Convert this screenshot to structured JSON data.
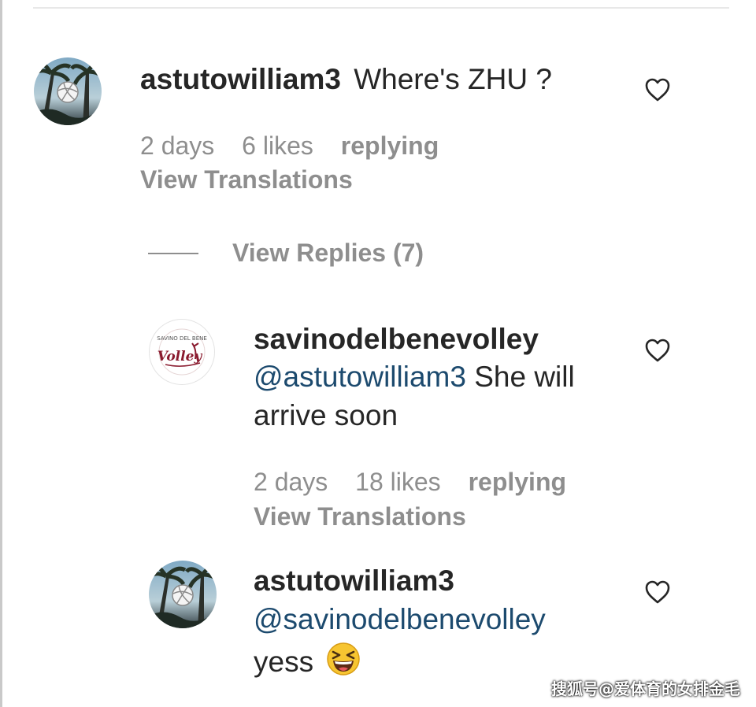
{
  "colors": {
    "username": "#262626",
    "meta": "#8e8e8e",
    "mention": "#1c4a6e",
    "background": "#ffffff"
  },
  "comments": [
    {
      "username": "astutowilliam3",
      "text": "Where's ZHU ?",
      "time": "2 days",
      "likes": "6 likes",
      "reply_label": "replying",
      "translate_label": "View Translations",
      "avatar_icon": "palm-tree-volleyball-avatar",
      "like_icon": "heart-icon"
    }
  ],
  "view_replies_label": "View Replies (7)",
  "replies": [
    {
      "username": "savinodelbenevolley",
      "mention": "@astutowilliam3",
      "text_1": " She will",
      "text_2": "arrive soon",
      "time": "2 days",
      "likes": "18 likes",
      "reply_label": "replying",
      "translate_label": "View Translations",
      "avatar_icon": "savino-del-bene-volley-logo",
      "avatar_logo_top": "SAVINO DEL BENE",
      "avatar_logo_script": "Volley",
      "like_icon": "heart-icon"
    },
    {
      "username": "astutowilliam3",
      "mention": "@savinodelbenevolley",
      "text": "yess",
      "emoji": "laughing-face-emoji",
      "avatar_icon": "palm-tree-volleyball-avatar",
      "like_icon": "heart-icon"
    }
  ],
  "watermark": "搜狐号@爱体育的女排金毛"
}
